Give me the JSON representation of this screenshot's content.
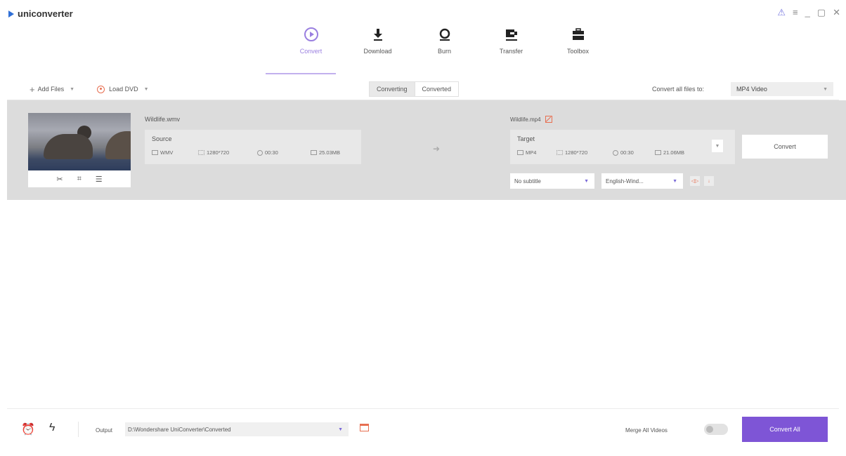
{
  "app": {
    "name": "uniconverter"
  },
  "window_controls": {
    "user": "⚠",
    "menu": "≡",
    "minimize": "_",
    "maximize": "▢",
    "close": "✕"
  },
  "nav": {
    "items": [
      {
        "label": "Convert",
        "icon": "convert-icon",
        "active": true
      },
      {
        "label": "Download",
        "icon": "download-icon"
      },
      {
        "label": "Burn",
        "icon": "burn-icon"
      },
      {
        "label": "Transfer",
        "icon": "transfer-icon"
      },
      {
        "label": "Toolbox",
        "icon": "toolbox-icon"
      }
    ]
  },
  "toolbar": {
    "add_files": "Add Files",
    "load_dvd": "Load DVD",
    "tab_converting": "Converting",
    "tab_converted": "Converted",
    "convert_all_label": "Convert all files to:",
    "format_value": "MP4 Video"
  },
  "file": {
    "source_name": "Wildlife.wmv",
    "source_label": "Source",
    "source_format": "WMV",
    "source_resolution": "1280*720",
    "source_duration": "00:30",
    "source_size": "25.03MB",
    "target_name": "Wildlife.mp4",
    "target_label": "Target",
    "target_format": "MP4",
    "target_resolution": "1280*720",
    "target_duration": "00:30",
    "target_size": "21.06MB",
    "subtitle": "No subtitle",
    "audio": "English-Wind...",
    "convert_button": "Convert"
  },
  "footer": {
    "output_label": "Output",
    "output_path": "D:\\Wondershare UniConverter\\Converted",
    "merge_label": "Merge All Videos",
    "merge_on": false,
    "convert_all_button": "Convert All"
  },
  "colors": {
    "accent": "#7e55d6",
    "brand": "#2f6fd6",
    "icon_orange": "#e76f51"
  }
}
